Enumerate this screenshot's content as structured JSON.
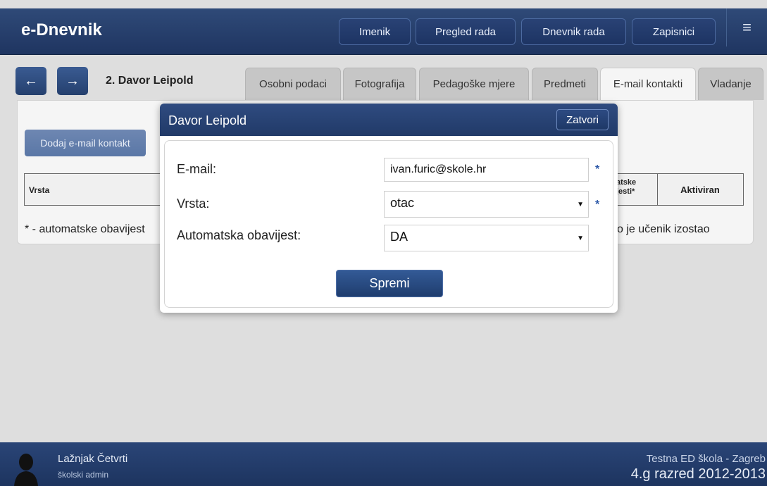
{
  "header": {
    "app_title": "e-Dnevnik",
    "nav": [
      "Imenik",
      "Pregled rada",
      "Dnevnik rada",
      "Zapisnici"
    ],
    "menu_icon": "hamburger-icon"
  },
  "student_bar": {
    "name": "2. Davor Leipold",
    "tabs": [
      "Osobni podaci",
      "Fotografija",
      "Pedagoške mjere",
      "Predmeti",
      "E-mail kontakti",
      "Vladanje"
    ],
    "active_tab": "E-mail kontakti"
  },
  "content": {
    "add_button": "Dodaj e-mail kontakt",
    "columns": {
      "vrsta": "Vrsta",
      "auto_fragment": "atske\njesti*",
      "aktiviran": "Aktiviran"
    },
    "footnote_left": "* - automatske obavijest",
    "footnote_right": "o je učenik izostao"
  },
  "modal": {
    "title": "Davor Leipold",
    "close_label": "Zatvori",
    "email_label": "E-mail:",
    "email_value": "ivan.furic@skole.hr",
    "vrsta_label": "Vrsta:",
    "vrsta_value": "otac",
    "auto_label": "Automatska obavijest:",
    "auto_value": "DA",
    "required_mark": "*",
    "save_label": "Spremi"
  },
  "footer": {
    "user_name": "Lažnjak Četvrti",
    "user_role": "školski admin",
    "school": "Testna ED škola - Zagreb",
    "grade": "4.g razred 2012-2013"
  },
  "colors": {
    "header_bg": "#26406d",
    "accent": "#2d59a8"
  }
}
